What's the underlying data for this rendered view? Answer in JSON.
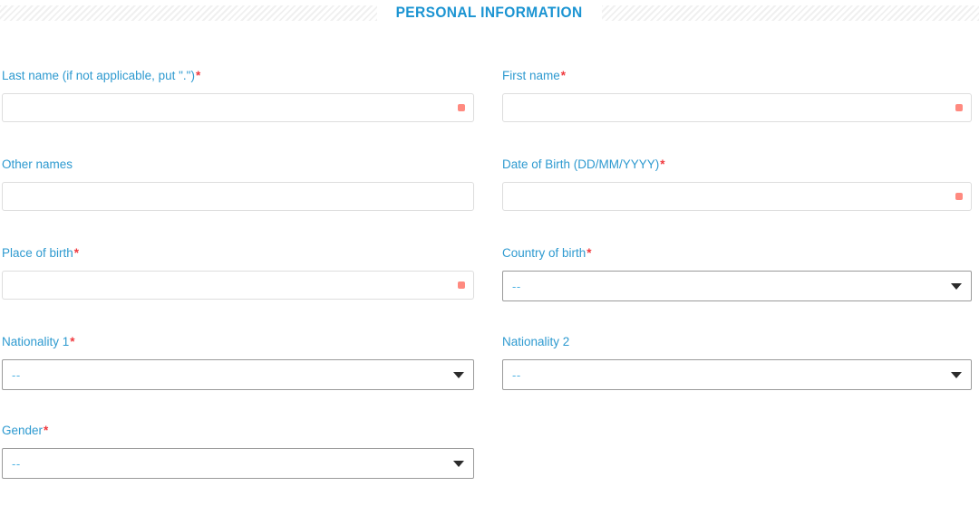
{
  "section": {
    "title": "PERSONAL INFORMATION",
    "accent_color": "#1b94d2",
    "label_color": "#2e9ad0",
    "required_marker_color": "#f0393e",
    "required_dot_color": "#ff8a80"
  },
  "required_marker": "*",
  "select_placeholder": "--",
  "rows": [
    {
      "left": {
        "label": "Last name (if not applicable, put \".\")",
        "required": true,
        "type": "text",
        "value": "",
        "placeholder": "",
        "required_dot": true
      },
      "right": {
        "label": "First name",
        "required": true,
        "type": "text",
        "value": "",
        "placeholder": "",
        "required_dot": true
      }
    },
    {
      "left": {
        "label": "Other names",
        "required": false,
        "type": "text",
        "value": "",
        "placeholder": "",
        "required_dot": false
      },
      "right": {
        "label": "Date of Birth (DD/MM/YYYY)",
        "required": true,
        "type": "text",
        "value": "",
        "placeholder": "",
        "required_dot": true
      }
    },
    {
      "left": {
        "label": "Place of birth",
        "required": true,
        "type": "text",
        "value": "",
        "placeholder": "",
        "required_dot": true
      },
      "right": {
        "label": "Country of birth",
        "required": true,
        "type": "select",
        "value": "--",
        "required_dot": false
      }
    },
    {
      "left": {
        "label": "Nationality 1",
        "required": true,
        "type": "select",
        "value": "--",
        "required_dot": false
      },
      "right": {
        "label": "Nationality 2",
        "required": false,
        "type": "select",
        "value": "--",
        "required_dot": false
      }
    },
    {
      "left": {
        "label": "Gender",
        "required": true,
        "type": "select",
        "value": "--",
        "required_dot": false
      },
      "right": null
    }
  ]
}
